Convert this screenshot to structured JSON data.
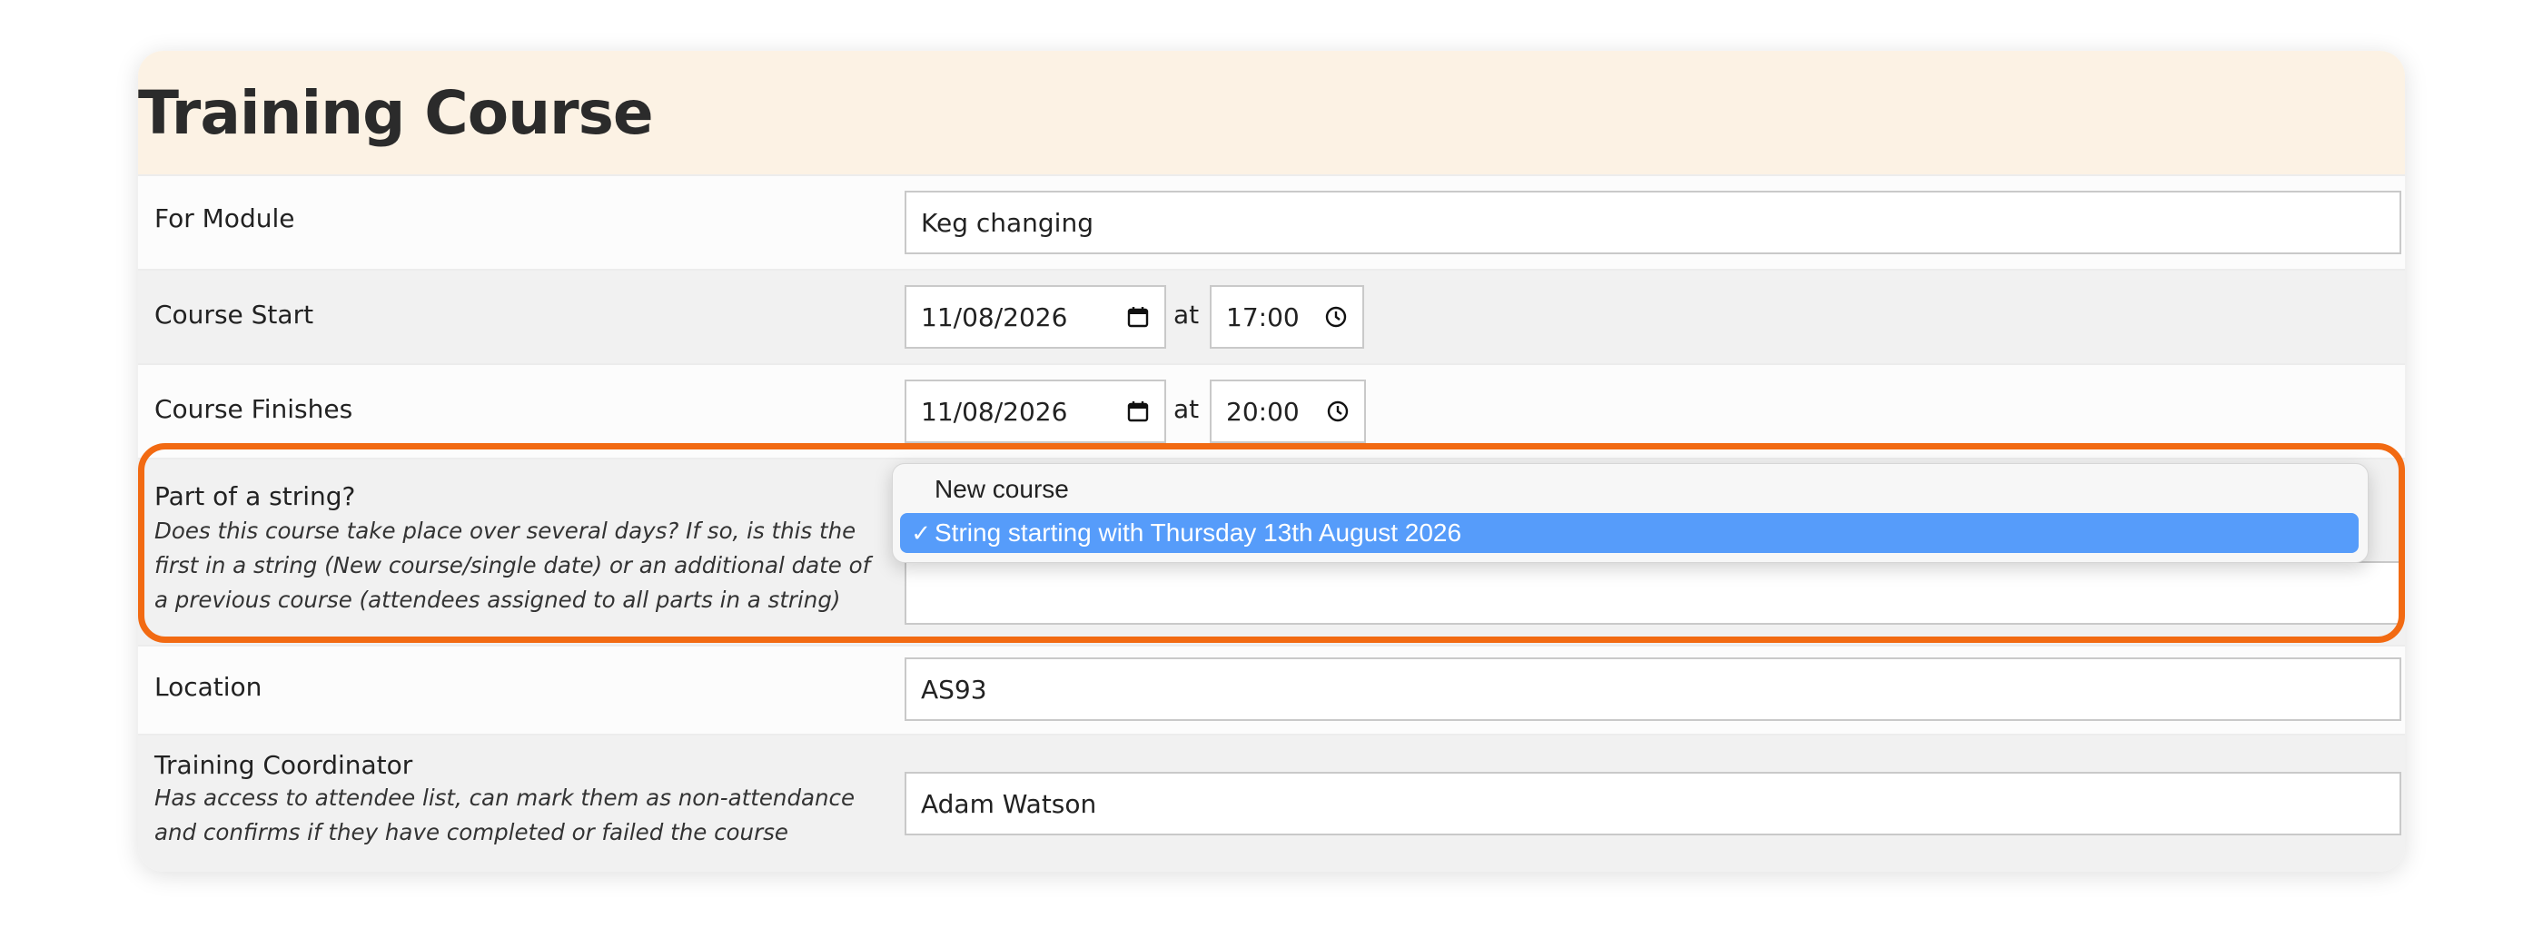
{
  "form": {
    "title": "Training Course",
    "module": {
      "label": "For Module",
      "value": "Keg changing"
    },
    "start": {
      "label": "Course Start",
      "date": "11/08/2026",
      "at": "at",
      "time": "17:00"
    },
    "finish": {
      "label": "Course Finishes",
      "date": "11/08/2026",
      "at": "at",
      "time": "20:00"
    },
    "string": {
      "label": "Part of a string?",
      "help": "Does this course take place over several days? If so, is this the first in a string (New course/single date) or an additional date of a previous course (attendees assigned to all parts in a string)"
    },
    "location": {
      "label": "Location",
      "value": "AS93"
    },
    "coordinator": {
      "label": "Training Coordinator",
      "help": "Has access to attendee list, can mark them as non-attendance and confirms if they have completed or failed the course",
      "value": "Adam Watson"
    }
  },
  "dropdown": {
    "options": [
      {
        "label": "New course"
      },
      {
        "label": "String starting with Thursday 13th August 2026"
      }
    ],
    "selected_index": 1,
    "check_mark": "✓"
  },
  "icons": {
    "date": "calendar-icon",
    "time": "clock-icon"
  },
  "colors": {
    "highlight": "#f26a12",
    "header_bg": "#fcf2e4",
    "selected_option": "#569cfa"
  }
}
